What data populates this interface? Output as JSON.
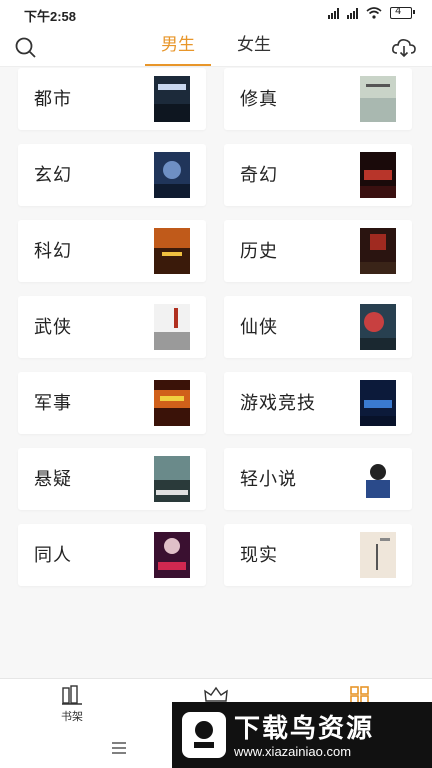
{
  "status_bar": {
    "time": "下午2:58",
    "battery": "4"
  },
  "top_bar": {
    "tabs": [
      {
        "label": "男生",
        "active": true
      },
      {
        "label": "女生",
        "active": false
      }
    ],
    "accent_color": "#e8962a"
  },
  "categories": [
    {
      "label": "都市"
    },
    {
      "label": "修真"
    },
    {
      "label": "玄幻"
    },
    {
      "label": "奇幻"
    },
    {
      "label": "科幻"
    },
    {
      "label": "历史"
    },
    {
      "label": "武侠"
    },
    {
      "label": "仙侠"
    },
    {
      "label": "军事"
    },
    {
      "label": "游戏竞技"
    },
    {
      "label": "悬疑"
    },
    {
      "label": "轻小说"
    },
    {
      "label": "同人"
    },
    {
      "label": "现实"
    }
  ],
  "bottom_nav": {
    "bookshelf_label": "书架"
  },
  "watermark": {
    "title": "下载鸟资源",
    "url": "www.xiazainiao.com"
  }
}
